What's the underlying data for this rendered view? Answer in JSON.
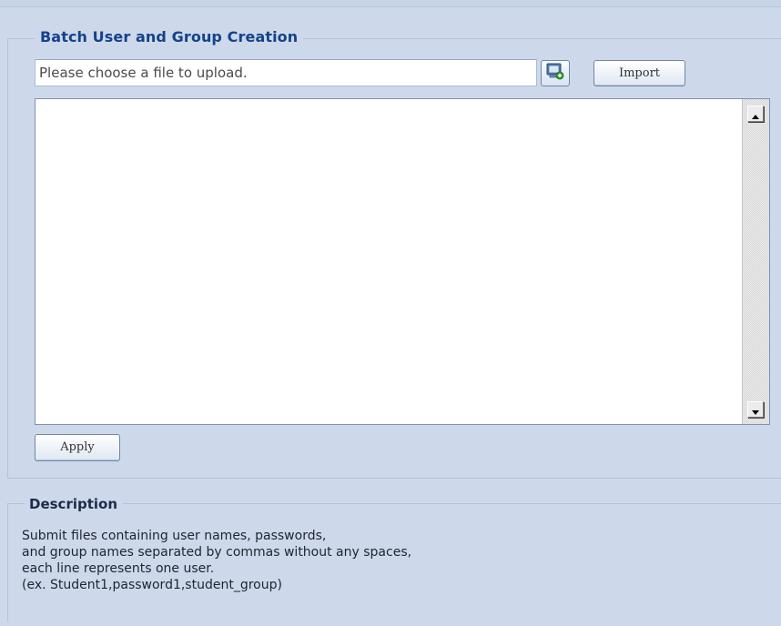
{
  "batch": {
    "legend": "Batch User and Group Creation",
    "file_placeholder": "Please choose a file to upload.",
    "browse_icon": "browse-file-icon",
    "import_label": "Import",
    "textarea_value": "",
    "apply_label": "Apply"
  },
  "description": {
    "legend": "Description",
    "lines": [
      "Submit files containing user names, passwords,",
      "and group names separated by commas without any spaces,",
      "each line represents one user.",
      "(ex. Student1,password1,student_group)"
    ]
  },
  "colors": {
    "background": "#cdd9ea",
    "legend_blue": "#15428b",
    "border": "#b3c4da"
  }
}
